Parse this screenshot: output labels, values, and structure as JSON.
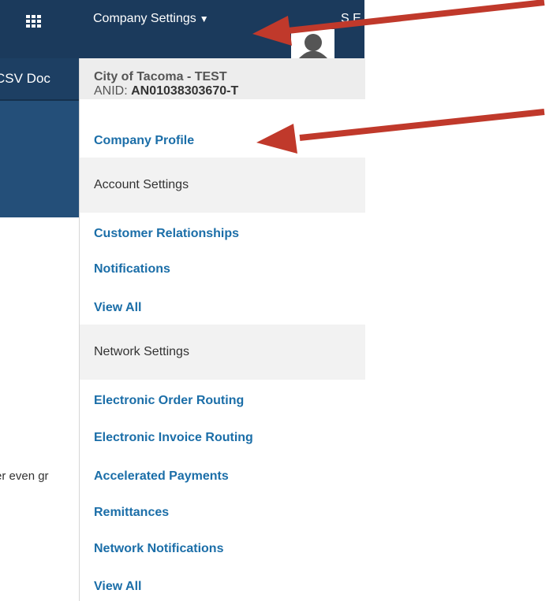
{
  "topbar": {
    "company_menu_label": "Company Settings",
    "user_label": "S E"
  },
  "background": {
    "tab_fragment": "CSV Doc",
    "body_fragment": "er even gr"
  },
  "dropdown": {
    "org_name": "City of Tacoma - TEST",
    "anid_label": "ANID:",
    "anid_value": "AN01038303670-T",
    "company_profile": "Company Profile",
    "account_settings_header": "Account Settings",
    "account_items": [
      "Customer Relationships",
      "Notifications",
      "View All"
    ],
    "network_settings_header": "Network Settings",
    "network_items": [
      "Electronic Order Routing",
      "Electronic Invoice Routing",
      "Accelerated Payments",
      "Remittances",
      "Network Notifications",
      "View All"
    ]
  },
  "colors": {
    "topbar": "#1b3a5c",
    "link": "#1b6ea8",
    "annotation_arrow": "#c0392b"
  },
  "icons": [
    "app-grid-icon",
    "caret-down-icon",
    "user-avatar-icon"
  ]
}
